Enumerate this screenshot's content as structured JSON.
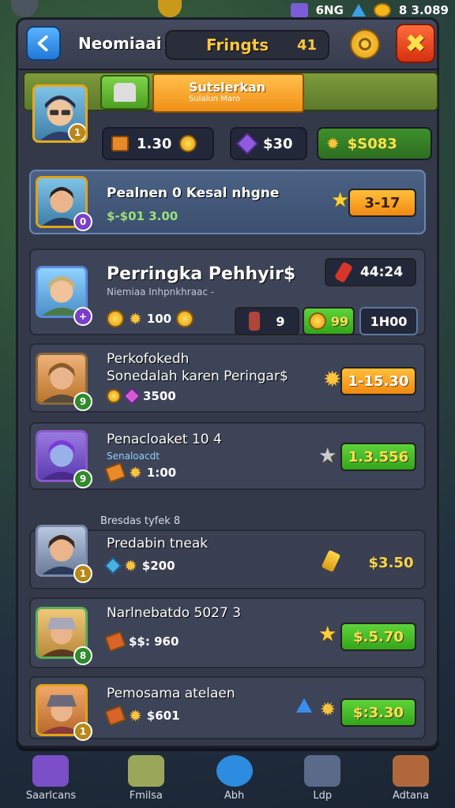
{
  "status": {
    "text": "6NG",
    "balance": "8 3.089"
  },
  "header": {
    "back_icon": "arrow-left-icon",
    "title": "Neomiaai",
    "pill_label": "Fringts",
    "pill_value": "41",
    "settings_icon": "gear-icon",
    "close_icon": "close-icon",
    "close_glyph": "✖"
  },
  "profile": {
    "banner_title": "Sutslerkan",
    "banner_sub": "Sulalun Maro",
    "level": "1",
    "res_a_value": "1.30",
    "res_b_value": "$30",
    "res_c_value": "$S083"
  },
  "rows": [
    {
      "name": "Pealnen 0 Kesal nhgne",
      "sub": "$-$01 3.00",
      "price": "3-17",
      "badge": "0"
    },
    {
      "name": "Perringka Pehhyir$",
      "sub": "Niemiaa Inhpnkhraac -",
      "stat_a": "100",
      "timer": "44:24",
      "b1": "9",
      "b2": "99",
      "b3": "1H00",
      "badge": "+"
    },
    {
      "name": "Perkofokedh",
      "name2": "Sonedalah karen Peringar$",
      "stat": "3500",
      "price": "1-15.30",
      "badge": "9"
    },
    {
      "name": "Penacloaket 10 4",
      "sub": "Senaloacdt",
      "stat": "1:00",
      "price": "1.3.556",
      "badge": "9"
    },
    {
      "section": "Bresdas tyfek 8",
      "name": "Predabin tneak",
      "stat": "$200",
      "price": "$3.50",
      "badge": "1"
    },
    {
      "name": "Narlnebatdo 5027 3",
      "stat": "$$: 960",
      "price": "$.5.70",
      "badge": "8"
    },
    {
      "name": "Pemosama atelaen",
      "stat": "$601",
      "price": "$:3.30",
      "badge": "1"
    }
  ],
  "nav": [
    {
      "label": "Saarlcans",
      "icon": "gem-icon",
      "color": "#7a4fc8"
    },
    {
      "label": "Fmilsa",
      "icon": "chest-icon",
      "color": "#9aa75a"
    },
    {
      "label": "Abh",
      "icon": "blue-orb-icon",
      "color": "#2d8be0"
    },
    {
      "label": "Ldp",
      "icon": "gear-chest-icon",
      "color": "#5a6a88"
    },
    {
      "label": "Adtana",
      "icon": "crate-icon",
      "color": "#b0683a"
    }
  ]
}
